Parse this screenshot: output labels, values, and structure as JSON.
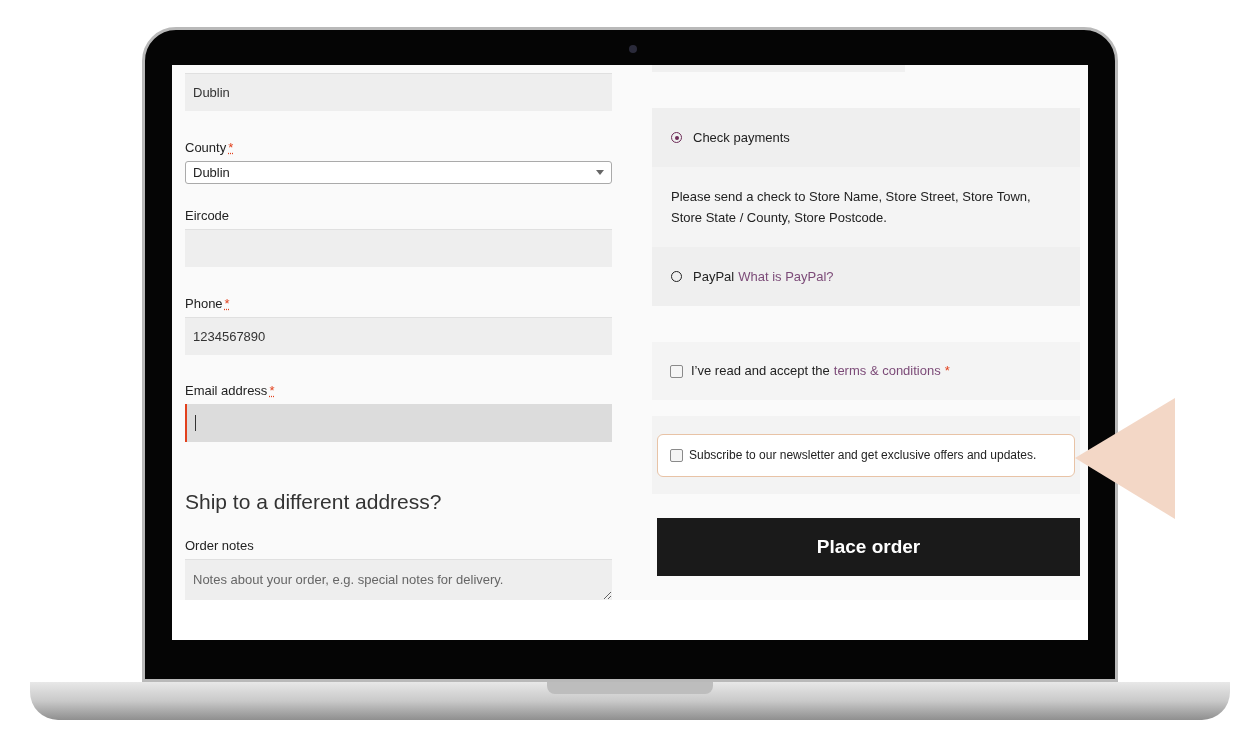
{
  "fields": [
    {
      "kind": "input",
      "value": "Dublin"
    },
    {
      "kind": "select",
      "label": "County",
      "required_mark": "*",
      "value": "Dublin"
    },
    {
      "kind": "input",
      "label": "Eircode"
    },
    {
      "kind": "input",
      "label": "Phone",
      "required_mark": "*",
      "value": "1234567890"
    },
    {
      "kind": "input",
      "label": "Email address",
      "required_mark": "*",
      "focused": true
    }
  ],
  "shipping_heading": "Ship to a different address?",
  "order_notes": {
    "label": "Order notes",
    "placeholder": "Notes about your order, e.g. special notes for delivery."
  },
  "payment_methods": [
    {
      "label": "Check payments",
      "selected": true,
      "description": "Please send a check to Store Name, Store Street, Store Town, Store State / County, Store Postcode."
    },
    {
      "label": "PayPal",
      "link": "What is PayPal?",
      "selected": false
    }
  ],
  "terms": {
    "text": "I’ve read and accept the",
    "link": "terms & conditions",
    "required_mark": "*",
    "checked": false
  },
  "newsletter": {
    "text": "Subscribe to our newsletter and get exclusive offers and updates.",
    "checked": false,
    "highlighted": true
  },
  "place_order": "Place order"
}
